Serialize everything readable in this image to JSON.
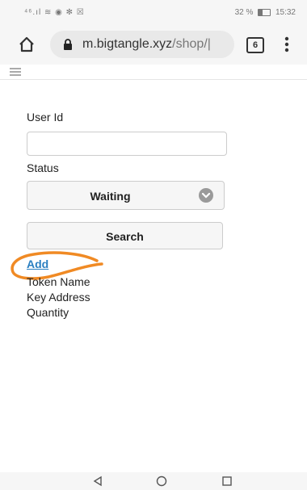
{
  "status_bar": {
    "signal_icons": "⁴⁶.ıl ≋ ◉ ✻ ☒",
    "battery_percent": "32 %",
    "time": "15:32"
  },
  "browser": {
    "url_host": "m.bigtangle.xyz",
    "url_path": "/shop/|",
    "tab_count": "6"
  },
  "form": {
    "user_id_label": "User Id",
    "user_id_value": "",
    "status_label": "Status",
    "status_selected": "Waiting",
    "search_label": "Search",
    "add_label": "Add"
  },
  "details": {
    "token_name_label": "Token Name",
    "key_address_label": "Key Address",
    "quantity_label": "Quantity"
  },
  "annotation_color": "#f08a24",
  "link_color": "#2a7fc1"
}
